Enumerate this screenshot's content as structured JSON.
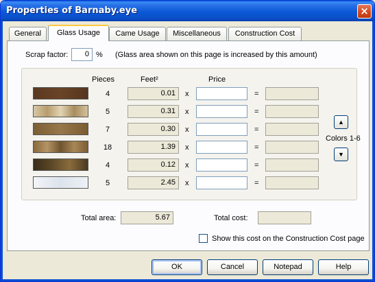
{
  "window": {
    "title": "Properties of Barnaby.eye",
    "close_glyph": "×"
  },
  "tabs": [
    {
      "label": "General",
      "active": false
    },
    {
      "label": "Glass Usage",
      "active": true
    },
    {
      "label": "Came Usage",
      "active": false
    },
    {
      "label": "Miscellaneous",
      "active": false
    },
    {
      "label": "Construction Cost",
      "active": false
    }
  ],
  "scrap": {
    "label": "Scrap factor:",
    "value": "0",
    "unit": "%",
    "note": "(Glass area shown on this page is increased by this amount)"
  },
  "table": {
    "headers": {
      "pieces": "Pieces",
      "feet": "Feet²",
      "price": "Price"
    },
    "times": "x",
    "equals": "=",
    "rows": [
      {
        "swatch_color": "#5a3820",
        "pieces": "4",
        "feet": "0.01",
        "price": "",
        "total": ""
      },
      {
        "swatch_color": "#c9b48e",
        "pieces": "5",
        "feet": "0.31",
        "price": "",
        "total": ""
      },
      {
        "swatch_color": "#8a6a3e",
        "pieces": "7",
        "feet": "0.30",
        "price": "",
        "total": ""
      },
      {
        "swatch_color": "#9c7a48",
        "pieces": "18",
        "feet": "1.39",
        "price": "",
        "total": ""
      },
      {
        "swatch_color": "#4a3a22",
        "pieces": "4",
        "feet": "0.12",
        "price": "",
        "total": ""
      },
      {
        "swatch_color": "#e6ebf2",
        "pieces": "5",
        "feet": "2.45",
        "price": "",
        "total": ""
      }
    ]
  },
  "colors_nav": {
    "label": "Colors 1-6",
    "up_icon": "▲",
    "down_icon": "▼"
  },
  "totals": {
    "area_label": "Total area:",
    "area_value": "5.67",
    "cost_label": "Total cost:",
    "cost_value": ""
  },
  "show_cost": {
    "label": "Show this cost on the Construction Cost page",
    "checked": false
  },
  "buttons": {
    "ok": "OK",
    "cancel": "Cancel",
    "notepad": "Notepad",
    "help": "Help"
  }
}
